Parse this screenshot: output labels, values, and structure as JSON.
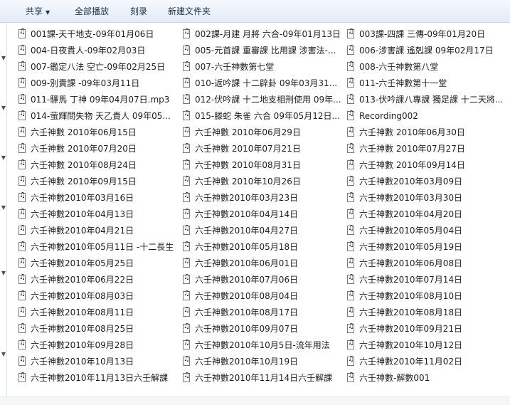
{
  "toolbar": {
    "share": "共享",
    "play_all": "全部播放",
    "burn": "刻录",
    "new_folder": "新建文件夹"
  },
  "files": {
    "col1": [
      "001課-天干地支-09年01月06日",
      "004-日夜貴人-09年02月03日",
      "007-鑑定八法 空亡-09年02月25日",
      "009-別責課 -09年03月11日",
      "011-驛馬 丁神 09年04月07日.mp3",
      "014-萤輝問失物 天乙貴人 09年05...",
      "六壬神數 2010年06月15日",
      "六壬神數 2010年07月20日",
      "六壬神數 2010年08月24日",
      "六壬神數 2010年09月15日",
      "六壬神數2010年03月16日",
      "六壬神數2010年04月13日",
      "六壬神數2010年04月21日",
      "六壬神數2010年05月11日 -十二長生",
      "六壬神數2010年05月25日",
      "六壬神數2010年06月22日",
      "六壬神數2010年08月03日",
      "六壬神數2010年08月11日",
      "六壬神數2010年08月25日",
      "六壬神數2010年09月28日",
      "六壬神數2010年10月13日",
      "六壬神數2010年11月13日六壬解課"
    ],
    "col2": [
      "002課-月建 月將 六合-09年01月13日",
      "005-元首課 重審課 比用課 涉害法-...",
      "007-六壬神數第七堂",
      "010-返吟課 十二辟卦 09年03月31...",
      "012-伏吟課 十二地支相刑使用 09年...",
      "015-滕蛇 朱雀 六合 09年05月12日...",
      "六壬神數 2010年06月29日",
      "六壬神數 2010年07月21日",
      "六壬神數 2010年08月31日",
      "六壬神數 2010年10月26日",
      "六壬神數2010年03月23日",
      "六壬神數2010年04月14日",
      "六壬神數2010年04月27日",
      "六壬神數2010年05月18日",
      "六壬神數2010年06月01日",
      "六壬神數2010年07月06日",
      "六壬神數2010年08月04日",
      "六壬神數2010年08月17日",
      "六壬神數2010年09月07日",
      "六壬神數2010年10月5日-流年用法",
      "六壬神數2010年10月19日",
      "六壬神數2010年11月14日六壬解課"
    ],
    "col3": [
      "003課-四課 三傳-09年01月20日",
      "006-涉害課 遙剋課 09年02月17日",
      "008-六壬神數第八堂",
      "011-六壬神數第十一堂",
      "013-伏吟課八專課 獨足課 十二天將...",
      "Recording002",
      "六壬神數 2010年06月30日",
      "六壬神數 2010年07月27日",
      "六壬神數 2010年09月14日",
      "六壬神數2010年03月09日",
      "六壬神數2010年03月30日",
      "六壬神數2010年04月20日",
      "六壬神數2010年05月04日",
      "六壬神數2010年05月19日",
      "六壬神數2010年06月08日",
      "六壬神數2010年07月14日",
      "六壬神數2010年08月10日",
      "六壬神數2010年08月18日",
      "六壬神數2010年09月21日",
      "六壬神數2010年10月12日",
      "六壬神數2010年11月02日",
      "六壬神數-解數001"
    ]
  }
}
